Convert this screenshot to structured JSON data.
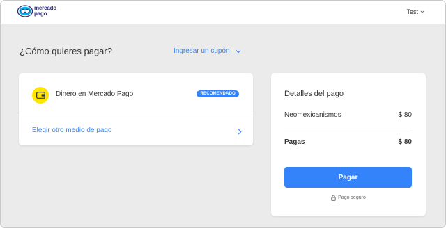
{
  "header": {
    "logo_text_line1": "mercado",
    "logo_text_line2": "pago",
    "user_name": "Test",
    "user_chevron_icon": "chevron-down-icon"
  },
  "main": {
    "title": "¿Cómo quieres pagar?",
    "coupon_link": "Ingresar un cupón",
    "methods": {
      "account_money_label": "Dinero en Mercado Pago",
      "recommended_badge": "RECOMENDADO",
      "wallet_icon": "wallet-icon",
      "other_method_link": "Elegir otro medio de pago",
      "other_method_icon": "chevron-right-icon"
    }
  },
  "summary": {
    "title": "Detalles del pago",
    "item_label": "Neomexicanismos",
    "item_amount": "$ 80",
    "total_label": "Pagas",
    "total_amount": "$ 80",
    "pay_button": "Pagar",
    "secure_label": "Pago seguro",
    "secure_icon": "lock-icon"
  },
  "colors": {
    "accent": "#3483fa",
    "brand_yellow": "#ffe600",
    "brand_navy": "#2d3277",
    "background": "#ebebeb"
  }
}
